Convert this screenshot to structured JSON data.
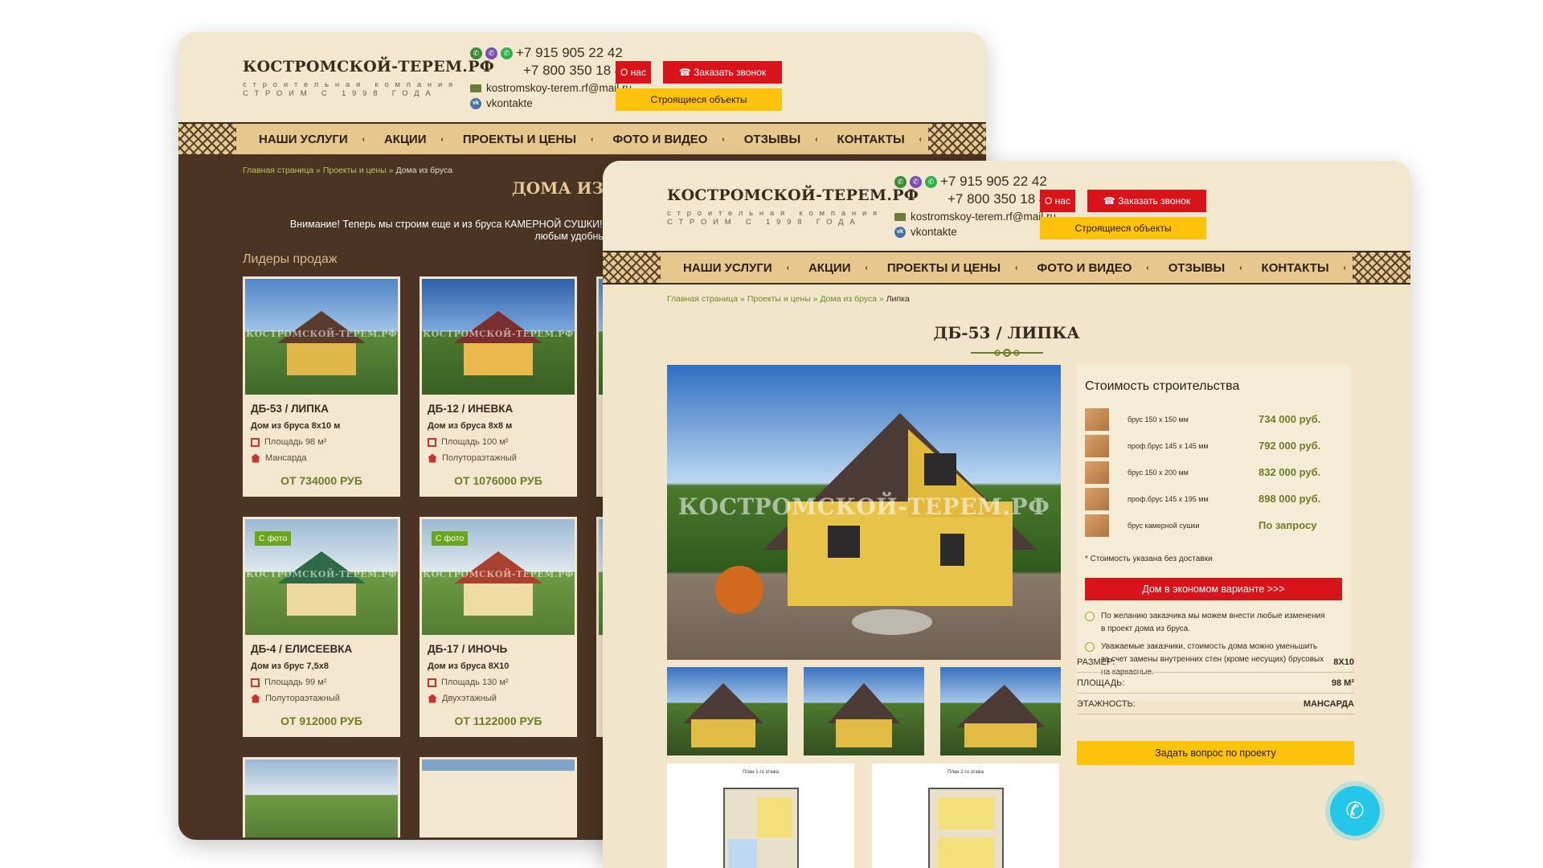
{
  "brand": {
    "title": "КОСТРОМСКОЙ-ТЕРЕМ.РФ",
    "subtitle_line1": "строительная компания",
    "subtitle_line2": "СТРОИМ С 1998 ГОДА",
    "watermark": "КОСТРОМСКОЙ-ТЕРЕМ.РФ"
  },
  "contacts": {
    "phone1": "+7 915 905 22 42",
    "phone2": "+7 800 350 18 42",
    "email": "kostromskoy-terem.rf@mail.ru",
    "vk": "vkontakte"
  },
  "header_buttons": {
    "about": "О нас",
    "callback": "Заказать звонок",
    "objects": "Строящиеся объекты"
  },
  "nav": [
    "НАШИ УСЛУГИ",
    "АКЦИИ",
    "ПРОЕКТЫ И ЦЕНЫ",
    "ФОТО И ВИДЕО",
    "ОТЗЫВЫ",
    "КОНТАКТЫ"
  ],
  "back_page": {
    "breadcrumbs": [
      "Главная страница",
      "Проекты и цены",
      "Дома из бруса"
    ],
    "title": "ДОМА ИЗ Б",
    "notice_line1": "Внимание! Теперь мы строим еще и из бруса КАМЕРНОЙ СУШКИ! П",
    "notice_line2": "любым удобным",
    "leaders": "Лидеры продаж",
    "cards": [
      {
        "name": "ДБ-53 / ЛИПКА",
        "desc": "Дом из бруса 8х10 м",
        "area": "Площадь 98 м²",
        "floors": "Мансарда",
        "price": "ОТ 734000 РУБ",
        "badge": ""
      },
      {
        "name": "ДБ-12 / ИНЕВКА",
        "desc": "Дом из бруса 8х8 м",
        "area": "Площадь 100 м²",
        "floors": "Полутораэтажный",
        "price": "ОТ 1076000 РУБ",
        "badge": ""
      },
      {
        "name": "ДБ-4 / ЕЛИСЕЕВКА",
        "desc": "Дом из брус 7,5х8",
        "area": "Площадь 99 м²",
        "floors": "Полутораэтажный",
        "price": "ОТ 912000 РУБ",
        "badge": "С фото"
      },
      {
        "name": "ДБ-17 / ИНОЧЬ",
        "desc": "Дом из бруса 8Х10",
        "area": "Площадь 130 м²",
        "floors": "Двухэтажный",
        "price": "ОТ 1122000 РУБ",
        "badge": "С фото"
      }
    ]
  },
  "front_page": {
    "breadcrumbs": [
      "Главная страница",
      "Проекты и цены",
      "Дома из бруса",
      "Липка"
    ],
    "title": "ДБ-53 / ЛИПКА",
    "cost_title": "Стоимость строительства",
    "prices": [
      {
        "name": "брус 150 х 150 мм",
        "price": "734 000 руб."
      },
      {
        "name": "проф.брус 145 х 145 мм",
        "price": "792 000 руб."
      },
      {
        "name": "брус 150 х 200 мм",
        "price": "832 000 руб."
      },
      {
        "name": "проф.брус 145 х 195 мм",
        "price": "898 000 руб."
      },
      {
        "name": "брус камерной сушки",
        "price": "По запросу"
      }
    ],
    "cost_note": "* Стоимость указана без доставки",
    "econom_button": "Дом в экономом варианте >>>",
    "info1": "По желанию заказчика мы можем внести любые изменения в проект дома из бруса.",
    "info2": "Уважаемые заказчики, стоимость дома можно уменьшить за счет замены внутренних стен (кроме несущих) брусовых на каркасные.",
    "specs": [
      {
        "key": "РАЗМЕР:",
        "value": "8Х10"
      },
      {
        "key": "ПЛОЩАДЬ:",
        "value": "98 М²"
      },
      {
        "key": "ЭТАЖНОСТЬ:",
        "value": "МАНСАРДА"
      }
    ],
    "ask_button": "Задать вопрос по проекту",
    "plan1_title": "План 1-го этажа",
    "plan2_title": "План 2-го этажа"
  },
  "colors": {
    "red": "#d8141b",
    "yellow": "#fdc20b",
    "dark_brown": "#4a3423",
    "green_price": "#6b7c2a",
    "call": "#25c7e8"
  },
  "icons": [
    "viber-icon",
    "messenger-icon",
    "whatsapp-icon",
    "mail-icon",
    "vk-icon",
    "phone-icon",
    "chevron-down-icon",
    "area-icon",
    "house-icon",
    "info-icon"
  ]
}
